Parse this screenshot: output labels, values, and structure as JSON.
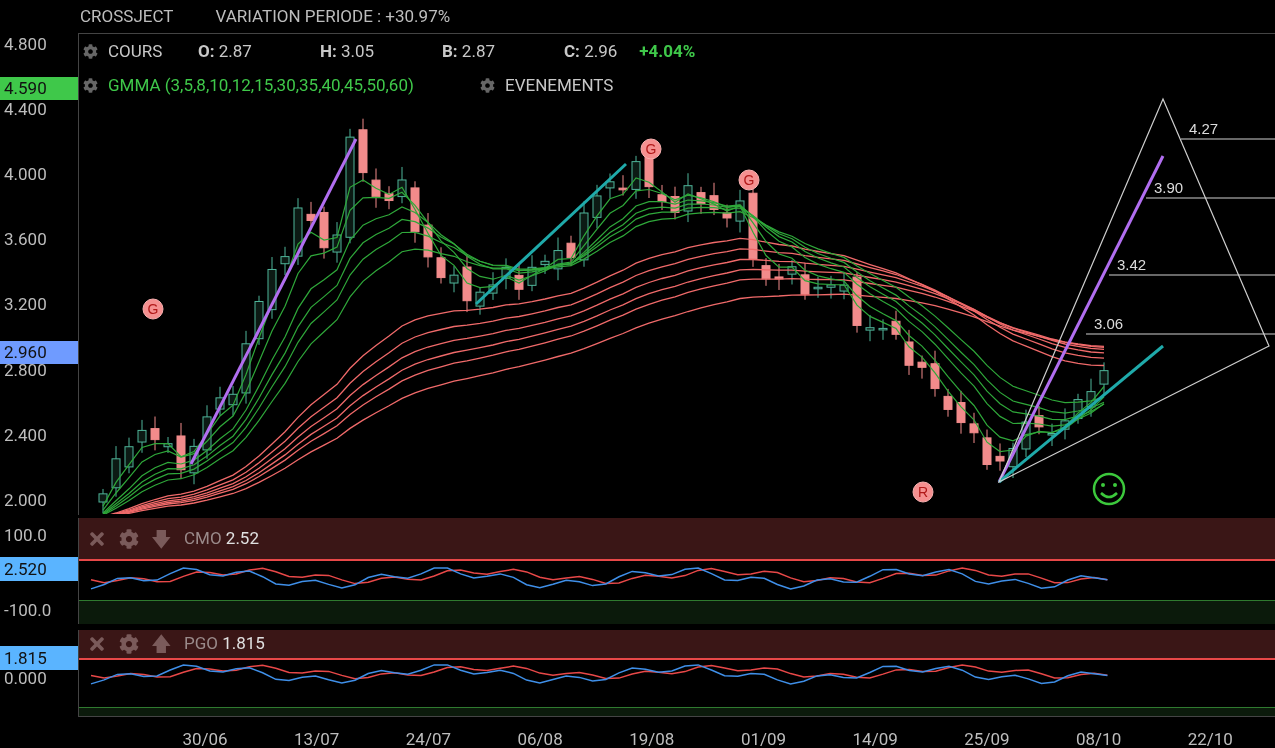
{
  "header": {
    "symbol": "CROSSJECT",
    "variation": "VARIATION PERIODE : +30.97%"
  },
  "legend": {
    "cours": {
      "label": "COURS",
      "fields": [
        {
          "key": "O:",
          "value": "2.87"
        },
        {
          "key": "H:",
          "value": "3.05"
        },
        {
          "key": "B:",
          "value": "2.87"
        },
        {
          "key": "C:",
          "value": "2.96"
        }
      ],
      "change": "+4.04%"
    },
    "gmma": "GMMA (3,5,8,10,12,15,30,35,40,45,50,60)",
    "events": "EVENEMENTS"
  },
  "price_axis": {
    "ticks": [
      "4.800",
      "4.400",
      "4.000",
      "3.600",
      "3.200",
      "2.800",
      "2.400",
      "2.000"
    ],
    "markers": [
      {
        "label": "4.590",
        "color": "#3fc84a"
      },
      {
        "label": "2.960",
        "color": "#6f9bff"
      }
    ]
  },
  "event_markers": [
    {
      "letter": "G"
    },
    {
      "letter": "G"
    },
    {
      "letter": "G"
    },
    {
      "letter": "R"
    }
  ],
  "fibonacci_levels": [
    "4.27",
    "3.90",
    "3.42",
    "3.06"
  ],
  "indicators": [
    {
      "name": "CMO",
      "value": "2.52",
      "arrow": "🡇",
      "axis": [
        "100.0",
        "-100.0"
      ],
      "marker": "2.520"
    },
    {
      "name": "PGO",
      "value": "1.815",
      "arrow": "🡅",
      "axis": [
        "0.000"
      ],
      "marker": "1.815"
    }
  ],
  "dates": [
    "30/06",
    "13/07",
    "24/07",
    "06/08",
    "19/08",
    "01/09",
    "14/09",
    "25/09",
    "08/10",
    "22/10"
  ]
}
